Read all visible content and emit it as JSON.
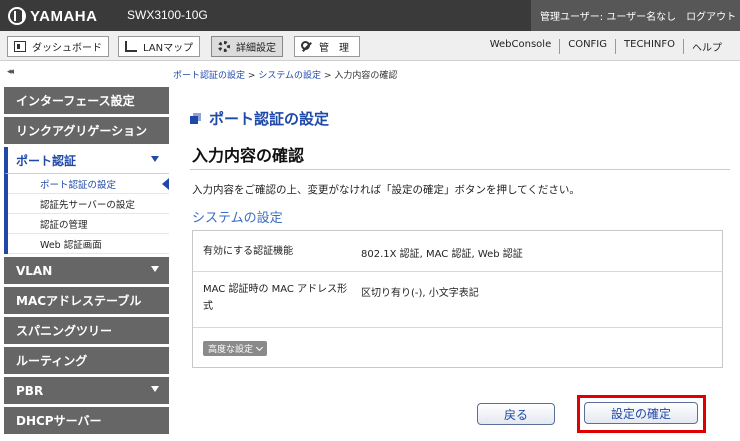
{
  "header": {
    "brand": "YAMAHA",
    "model": "SWX3100-10G",
    "user_label": "管理ユーザー: ユーザー名なし",
    "logout": "ログアウト"
  },
  "toolbar": {
    "tabs": [
      {
        "label": "ダッシュボード",
        "icon": "dashboard-icon"
      },
      {
        "label": "LANマップ",
        "icon": "lan-map-icon"
      },
      {
        "label": "詳細設定",
        "icon": "gear-icon",
        "active": true
      },
      {
        "label": "管　理",
        "icon": "wrench-icon"
      }
    ],
    "links": [
      "WebConsole",
      "CONFIG",
      "TECHINFO",
      "ヘルプ"
    ]
  },
  "breadcrumb": {
    "collapse": "◂◂",
    "items": [
      "ポート認証の設定",
      "システムの設定",
      "入力内容の確認"
    ],
    "separator": ">"
  },
  "sidebar": {
    "items": [
      {
        "label": "インターフェース設定"
      },
      {
        "label": "リンクアグリゲーション"
      },
      {
        "label": "ポート認証",
        "expanded": true
      },
      {
        "label": "VLAN"
      },
      {
        "label": "MACアドレステーブル"
      },
      {
        "label": "スパニングツリー"
      },
      {
        "label": "ルーティング"
      },
      {
        "label": "PBR"
      },
      {
        "label": "DHCPサーバー"
      }
    ],
    "subitems": [
      "ポート認証の設定",
      "認証先サーバーの設定",
      "認証の管理",
      "Web 認証画面"
    ]
  },
  "main": {
    "section_title": "ポート認証の設定",
    "page_title": "入力内容の確認",
    "description": "入力内容をご確認の上、変更がなければ「設定の確定」ボタンを押してください。",
    "subtitle": "システムの設定",
    "rows": [
      {
        "key": "有効にする認証機能",
        "value": "802.1X 認証, MAC 認証, Web 認証"
      },
      {
        "key": "MAC 認証時の MAC アドレス形式",
        "value": "区切り有り(-), 小文字表記"
      }
    ],
    "advanced_button": "高度な設定",
    "back_button": "戻る",
    "confirm_button": "設定の確定"
  },
  "colors": {
    "accent": "#1f49a8",
    "highlight": "#e10000"
  }
}
